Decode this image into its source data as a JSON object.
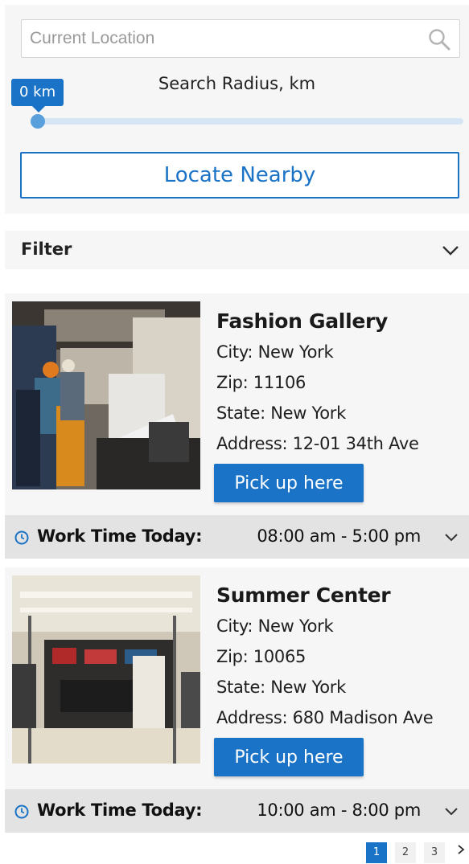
{
  "search": {
    "placeholder": "Current Location",
    "radius_label": "Search Radius, km",
    "radius_value_label": "0 km",
    "radius_value": 0,
    "locate_label": "Locate Nearby"
  },
  "filter": {
    "label": "Filter"
  },
  "stores": [
    {
      "name": "Fashion Gallery",
      "city": "City: New York",
      "zip": "Zip: 11106",
      "state": "State: New York",
      "address": "Address: 12-01 34th Ave",
      "pickup_label": "Pick up here",
      "worktime_label": "Work Time Today:",
      "hours": "08:00 am - 5:00 pm"
    },
    {
      "name": "Summer Center",
      "city": "City: New York",
      "zip": "Zip: 10065",
      "state": "State: New York",
      "address": "Address: 680 Madison Ave",
      "pickup_label": "Pick up here",
      "worktime_label": "Work Time Today:",
      "hours": "10:00 am - 8:00 pm"
    }
  ],
  "pagination": {
    "pages": [
      "1",
      "2",
      "3"
    ],
    "current": "1",
    "next_icon": "chevron-right-icon"
  },
  "colors": {
    "accent": "#1a73c6",
    "panel_bg": "#f6f6f6",
    "worktime_bg": "#e3e3e3"
  }
}
